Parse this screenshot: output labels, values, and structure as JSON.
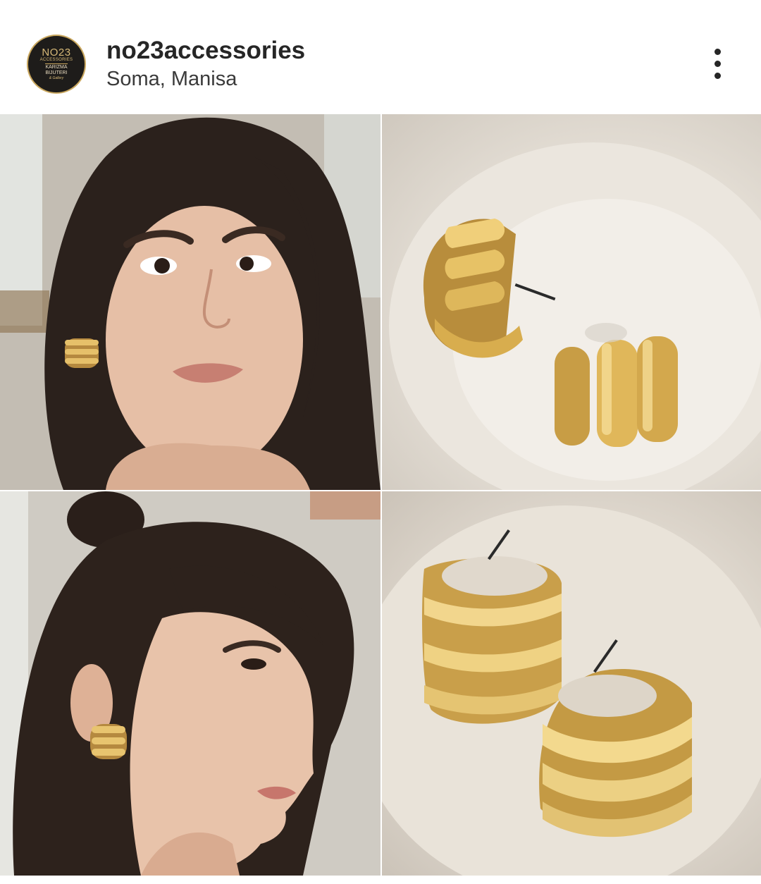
{
  "post": {
    "username": "no23accessories",
    "location": "Soma, Manisa",
    "avatar": {
      "line1": "NO23",
      "line2": "ACCESSORIES",
      "line3": "KARIZMA",
      "line4": "BIJUTERI",
      "line5": "& Gallery"
    },
    "more_icon": "more-vertical-icon"
  },
  "images": [
    {
      "name": "model-wearing-earrings-front"
    },
    {
      "name": "gold-earrings-in-dish"
    },
    {
      "name": "model-wearing-earrings-profile"
    },
    {
      "name": "gold-earrings-closeup"
    }
  ],
  "colors": {
    "gold": "#c9a75e",
    "text": "#262626"
  }
}
